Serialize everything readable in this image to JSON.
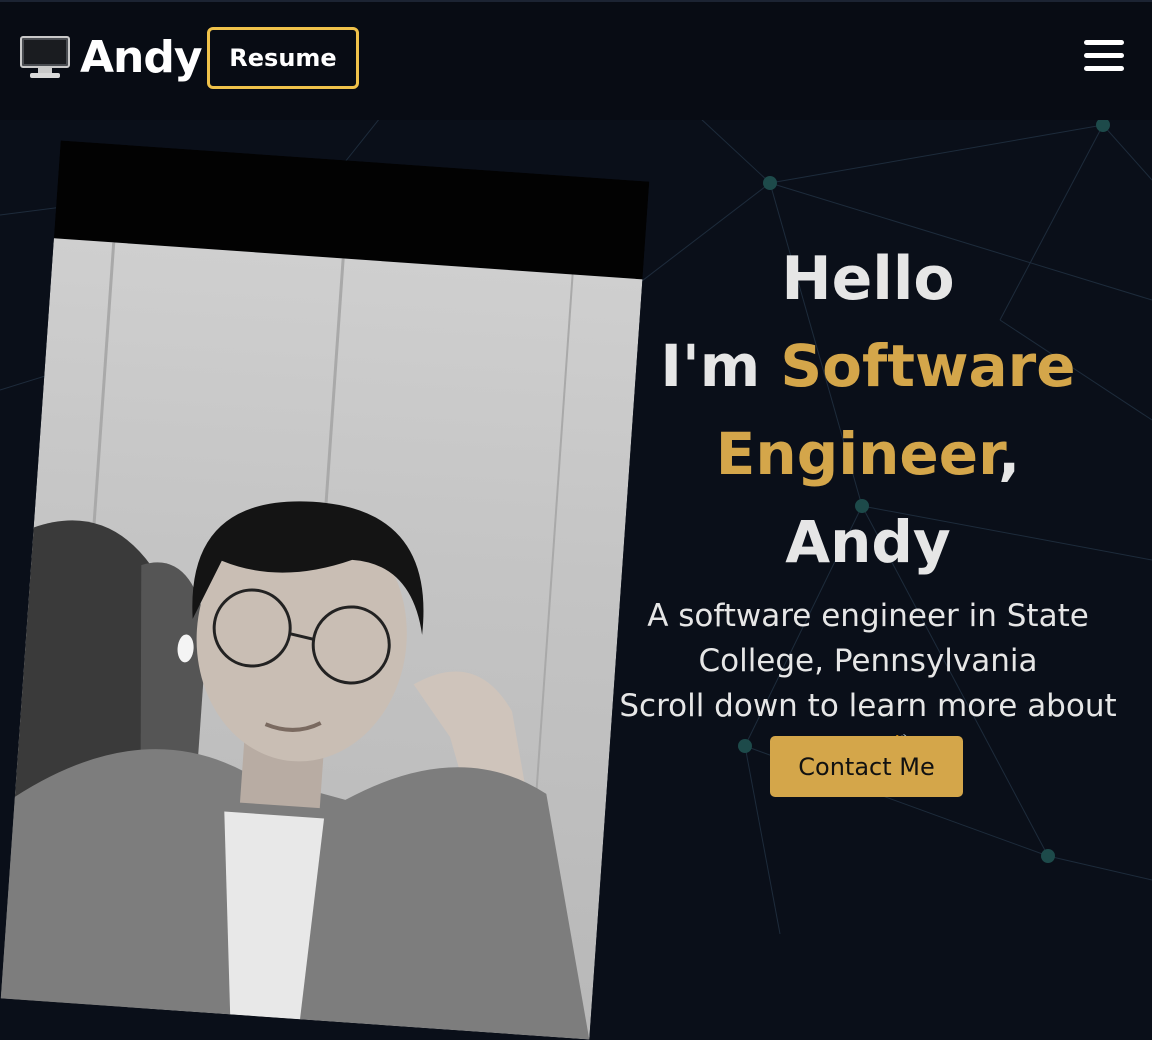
{
  "nav": {
    "brand_icon": "computer-monitor-icon",
    "brand_name": "Andy",
    "resume_label": "Resume",
    "menu_icon": "hamburger-menu-icon"
  },
  "hero": {
    "greeting": "Hello",
    "intro_prefix": "I'm ",
    "role": "Software Engineer",
    "intro_suffix": ", Andy",
    "description": "A software engineer in State College, Pennsylvania",
    "scroll_text": "Scroll down to learn more about me",
    "wave_emoji": "👋",
    "contact_label": "Contact Me",
    "photo_alt": "Portrait photo of Andy"
  },
  "colors": {
    "background": "#0a0f19",
    "navbar": "#080c14",
    "accent": "#d4a64a",
    "resume_border": "#f0c24a",
    "network_node": "#1d4a4a"
  }
}
